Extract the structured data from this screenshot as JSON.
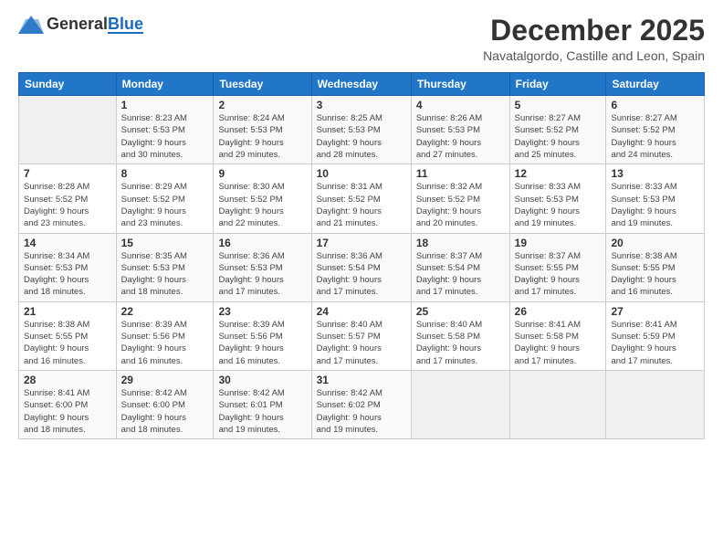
{
  "header": {
    "logo_general": "General",
    "logo_blue": "Blue",
    "month_title": "December 2025",
    "location": "Navatalgordo, Castille and Leon, Spain"
  },
  "weekdays": [
    "Sunday",
    "Monday",
    "Tuesday",
    "Wednesday",
    "Thursday",
    "Friday",
    "Saturday"
  ],
  "weeks": [
    [
      {
        "day": "",
        "info": ""
      },
      {
        "day": "1",
        "info": "Sunrise: 8:23 AM\nSunset: 5:53 PM\nDaylight: 9 hours\nand 30 minutes."
      },
      {
        "day": "2",
        "info": "Sunrise: 8:24 AM\nSunset: 5:53 PM\nDaylight: 9 hours\nand 29 minutes."
      },
      {
        "day": "3",
        "info": "Sunrise: 8:25 AM\nSunset: 5:53 PM\nDaylight: 9 hours\nand 28 minutes."
      },
      {
        "day": "4",
        "info": "Sunrise: 8:26 AM\nSunset: 5:53 PM\nDaylight: 9 hours\nand 27 minutes."
      },
      {
        "day": "5",
        "info": "Sunrise: 8:27 AM\nSunset: 5:52 PM\nDaylight: 9 hours\nand 25 minutes."
      },
      {
        "day": "6",
        "info": "Sunrise: 8:27 AM\nSunset: 5:52 PM\nDaylight: 9 hours\nand 24 minutes."
      }
    ],
    [
      {
        "day": "7",
        "info": "Sunrise: 8:28 AM\nSunset: 5:52 PM\nDaylight: 9 hours\nand 23 minutes."
      },
      {
        "day": "8",
        "info": "Sunrise: 8:29 AM\nSunset: 5:52 PM\nDaylight: 9 hours\nand 23 minutes."
      },
      {
        "day": "9",
        "info": "Sunrise: 8:30 AM\nSunset: 5:52 PM\nDaylight: 9 hours\nand 22 minutes."
      },
      {
        "day": "10",
        "info": "Sunrise: 8:31 AM\nSunset: 5:52 PM\nDaylight: 9 hours\nand 21 minutes."
      },
      {
        "day": "11",
        "info": "Sunrise: 8:32 AM\nSunset: 5:52 PM\nDaylight: 9 hours\nand 20 minutes."
      },
      {
        "day": "12",
        "info": "Sunrise: 8:33 AM\nSunset: 5:53 PM\nDaylight: 9 hours\nand 19 minutes."
      },
      {
        "day": "13",
        "info": "Sunrise: 8:33 AM\nSunset: 5:53 PM\nDaylight: 9 hours\nand 19 minutes."
      }
    ],
    [
      {
        "day": "14",
        "info": "Sunrise: 8:34 AM\nSunset: 5:53 PM\nDaylight: 9 hours\nand 18 minutes."
      },
      {
        "day": "15",
        "info": "Sunrise: 8:35 AM\nSunset: 5:53 PM\nDaylight: 9 hours\nand 18 minutes."
      },
      {
        "day": "16",
        "info": "Sunrise: 8:36 AM\nSunset: 5:53 PM\nDaylight: 9 hours\nand 17 minutes."
      },
      {
        "day": "17",
        "info": "Sunrise: 8:36 AM\nSunset: 5:54 PM\nDaylight: 9 hours\nand 17 minutes."
      },
      {
        "day": "18",
        "info": "Sunrise: 8:37 AM\nSunset: 5:54 PM\nDaylight: 9 hours\nand 17 minutes."
      },
      {
        "day": "19",
        "info": "Sunrise: 8:37 AM\nSunset: 5:55 PM\nDaylight: 9 hours\nand 17 minutes."
      },
      {
        "day": "20",
        "info": "Sunrise: 8:38 AM\nSunset: 5:55 PM\nDaylight: 9 hours\nand 16 minutes."
      }
    ],
    [
      {
        "day": "21",
        "info": "Sunrise: 8:38 AM\nSunset: 5:55 PM\nDaylight: 9 hours\nand 16 minutes."
      },
      {
        "day": "22",
        "info": "Sunrise: 8:39 AM\nSunset: 5:56 PM\nDaylight: 9 hours\nand 16 minutes."
      },
      {
        "day": "23",
        "info": "Sunrise: 8:39 AM\nSunset: 5:56 PM\nDaylight: 9 hours\nand 16 minutes."
      },
      {
        "day": "24",
        "info": "Sunrise: 8:40 AM\nSunset: 5:57 PM\nDaylight: 9 hours\nand 17 minutes."
      },
      {
        "day": "25",
        "info": "Sunrise: 8:40 AM\nSunset: 5:58 PM\nDaylight: 9 hours\nand 17 minutes."
      },
      {
        "day": "26",
        "info": "Sunrise: 8:41 AM\nSunset: 5:58 PM\nDaylight: 9 hours\nand 17 minutes."
      },
      {
        "day": "27",
        "info": "Sunrise: 8:41 AM\nSunset: 5:59 PM\nDaylight: 9 hours\nand 17 minutes."
      }
    ],
    [
      {
        "day": "28",
        "info": "Sunrise: 8:41 AM\nSunset: 6:00 PM\nDaylight: 9 hours\nand 18 minutes."
      },
      {
        "day": "29",
        "info": "Sunrise: 8:42 AM\nSunset: 6:00 PM\nDaylight: 9 hours\nand 18 minutes."
      },
      {
        "day": "30",
        "info": "Sunrise: 8:42 AM\nSunset: 6:01 PM\nDaylight: 9 hours\nand 19 minutes."
      },
      {
        "day": "31",
        "info": "Sunrise: 8:42 AM\nSunset: 6:02 PM\nDaylight: 9 hours\nand 19 minutes."
      },
      {
        "day": "",
        "info": ""
      },
      {
        "day": "",
        "info": ""
      },
      {
        "day": "",
        "info": ""
      }
    ]
  ]
}
